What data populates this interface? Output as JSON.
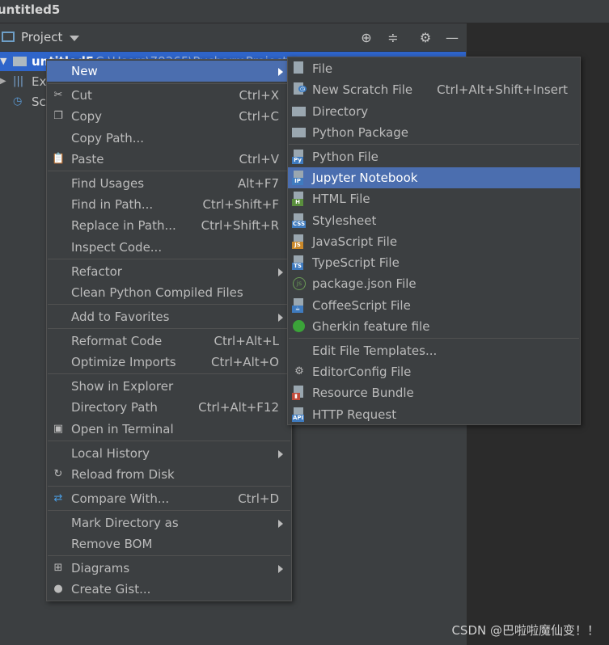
{
  "window": {
    "title": "untitled5"
  },
  "panel": {
    "label": "Project"
  },
  "tree": {
    "root_label": "untitled5",
    "root_path": "C:\\Users\\78265\\PycharmProjects",
    "items": [
      {
        "label": "Ext"
      },
      {
        "label": "Sc"
      }
    ]
  },
  "context_menu": {
    "new": "New",
    "cut": "Cut",
    "cut_sc": "Ctrl+X",
    "copy": "Copy",
    "copy_sc": "Ctrl+C",
    "copy_path": "Copy Path...",
    "paste": "Paste",
    "paste_sc": "Ctrl+V",
    "find_usages": "Find Usages",
    "find_usages_sc": "Alt+F7",
    "find_in_path": "Find in Path...",
    "find_in_path_sc": "Ctrl+Shift+F",
    "replace_in_path": "Replace in Path...",
    "replace_in_path_sc": "Ctrl+Shift+R",
    "inspect_code": "Inspect Code...",
    "refactor": "Refactor",
    "clean_python": "Clean Python Compiled Files",
    "add_favorites": "Add to Favorites",
    "reformat": "Reformat Code",
    "reformat_sc": "Ctrl+Alt+L",
    "optimize": "Optimize Imports",
    "optimize_sc": "Ctrl+Alt+O",
    "show_explorer": "Show in Explorer",
    "directory_path": "Directory Path",
    "directory_path_sc": "Ctrl+Alt+F12",
    "open_terminal": "Open in Terminal",
    "local_history": "Local History",
    "reload": "Reload from Disk",
    "compare": "Compare With...",
    "compare_sc": "Ctrl+D",
    "mark_dir": "Mark Directory as",
    "remove_bom": "Remove BOM",
    "diagrams": "Diagrams",
    "create_gist": "Create Gist..."
  },
  "new_submenu": {
    "file": "File",
    "scratch": "New Scratch File",
    "scratch_sc": "Ctrl+Alt+Shift+Insert",
    "directory": "Directory",
    "python_package": "Python Package",
    "python_file": "Python File",
    "jupyter": "Jupyter Notebook",
    "html": "HTML File",
    "stylesheet": "Stylesheet",
    "javascript": "JavaScript File",
    "typescript": "TypeScript File",
    "package_json": "package.json File",
    "coffeescript": "CoffeeScript File",
    "gherkin": "Gherkin feature file",
    "edit_templates": "Edit File Templates...",
    "editorconfig": "EditorConfig File",
    "resource_bundle": "Resource Bundle",
    "http_request": "HTTP Request"
  },
  "watermark": "CSDN @巴啦啦魔仙变！！",
  "colors": {
    "selection": "#4b6eaf",
    "tree_selection": "#2f65ca",
    "background": "#3c3f41"
  }
}
